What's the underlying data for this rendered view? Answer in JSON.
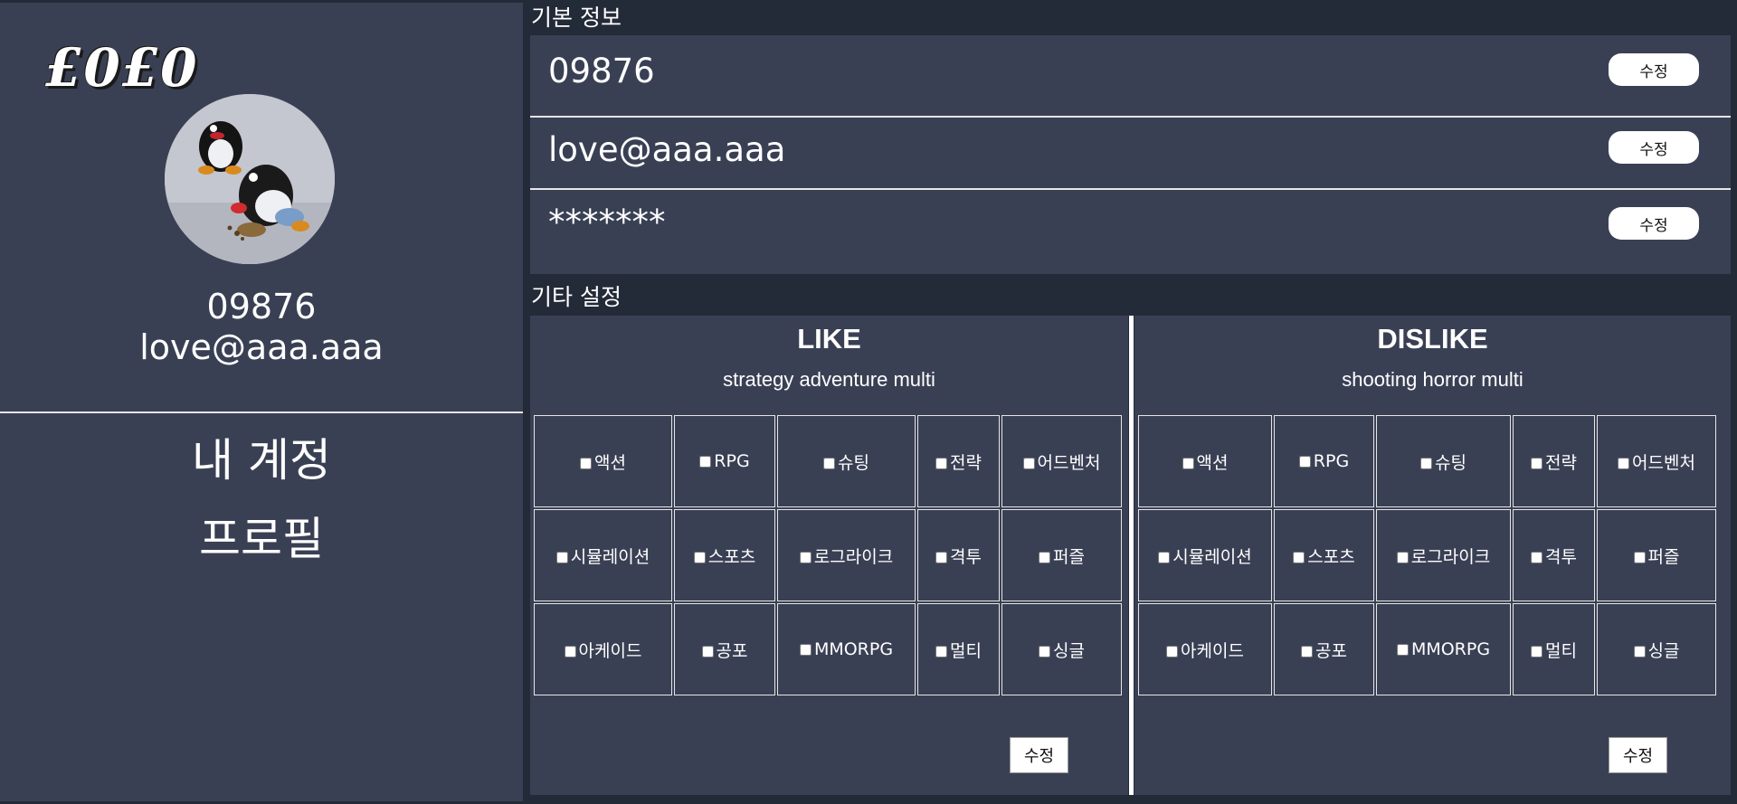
{
  "sidebar": {
    "logo": "£0£0",
    "user_id": "09876",
    "email": "love@aaa.aaa",
    "menu": [
      {
        "label": "내 계정"
      },
      {
        "label": "프로필"
      }
    ]
  },
  "basic_info": {
    "title": "기본 정보",
    "rows": [
      {
        "value": "09876",
        "button": "수정"
      },
      {
        "value": "love@aaa.aaa",
        "button": "수정"
      },
      {
        "value": "*******",
        "button": "수정"
      }
    ]
  },
  "other_settings": {
    "title": "기타 설정",
    "like": {
      "heading": "LIKE",
      "summary": "strategy adventure multi",
      "button": "수정",
      "genres": [
        [
          "액션",
          "RPG",
          "슈팅",
          "전략",
          "어드벤처"
        ],
        [
          "시뮬레이션",
          "스포츠",
          "로그라이크",
          "격투",
          "퍼즐"
        ],
        [
          "아케이드",
          "공포",
          "MMORPG",
          "멀티",
          "싱글"
        ]
      ]
    },
    "dislike": {
      "heading": "DISLIKE",
      "summary": "shooting horror multi",
      "button": "수정",
      "genres": [
        [
          "액션",
          "RPG",
          "슈팅",
          "전략",
          "어드벤처"
        ],
        [
          "시뮬레이션",
          "스포츠",
          "로그라이크",
          "격투",
          "퍼즐"
        ],
        [
          "아케이드",
          "공포",
          "MMORPG",
          "멀티",
          "싱글"
        ]
      ]
    }
  }
}
